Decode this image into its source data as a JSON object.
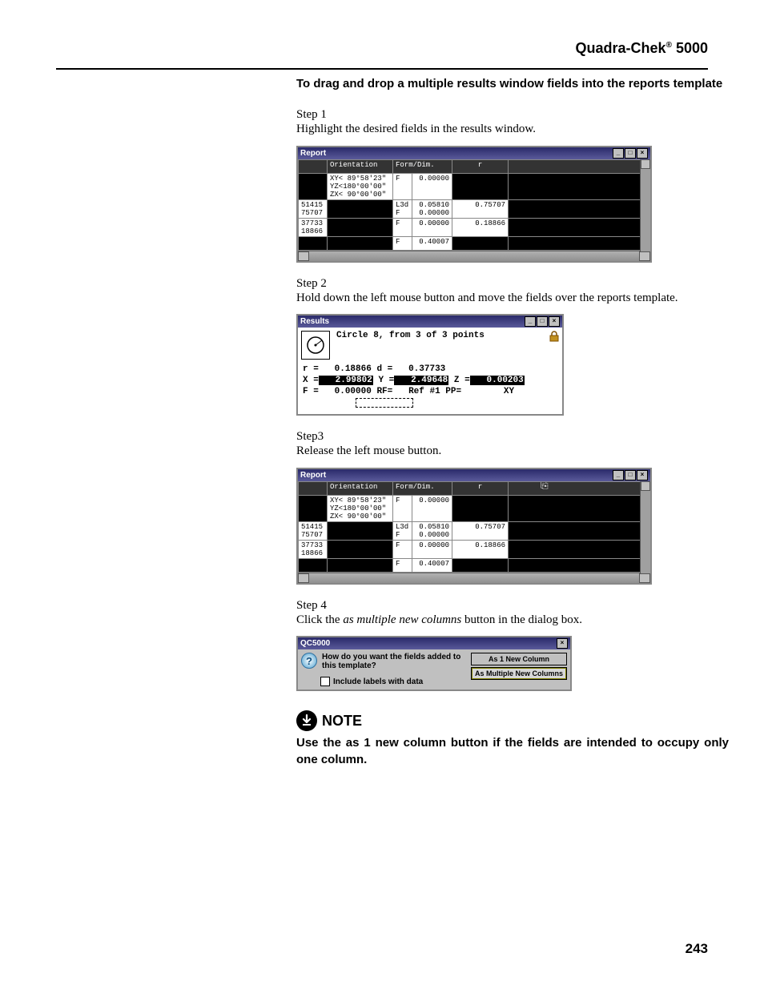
{
  "header": {
    "product": "Quadra-Chek",
    "reg": "®",
    "model": "5000"
  },
  "section_heading": "To drag and drop a multiple results window fields into the reports template",
  "steps": {
    "s1_label": "Step 1",
    "s1_body": "Highlight the desired fields in the results window.",
    "s2_label": "Step 2",
    "s2_body": "Hold down the left mouse button and move the fields over the reports template.",
    "s3_label": "Step3",
    "s3_body": "Release the left mouse button.",
    "s4_label": "Step 4",
    "s4_body_pre": "Click the ",
    "s4_body_ital": "as multiple new columns",
    "s4_body_post": " button in the dialog box."
  },
  "report_win": {
    "title": "Report",
    "headers": {
      "c1": "",
      "c2": "Orientation",
      "c3": "Form/Dim.",
      "c4": "r",
      "c5": ""
    },
    "rows": [
      {
        "c1": "",
        "c2a": "XY< 89°58'23\"",
        "c2b": "YZ<180°00'00\"",
        "c2c": "ZX< 90°00'00\"",
        "c3a": "F",
        "c3b": "0.00000",
        "c4": "",
        "hl": false
      },
      {
        "c1a": "51415",
        "c1b": "75707",
        "c3a": "L3d",
        "c3aval": "0.05810",
        "c3b": "F",
        "c3bval": "0.00000",
        "c4": "0.75707",
        "hl": true
      },
      {
        "c1a": "37733",
        "c1b": "18866",
        "c3a": "F",
        "c3aval": "0.00000",
        "c4": "0.18866",
        "hl": true
      },
      {
        "c3a": "F",
        "c3aval": "0.40007",
        "hl": false
      }
    ]
  },
  "results_win": {
    "title": "Results",
    "desc": "Circle 8, from 3 of 3 points",
    "r_label": "r =",
    "r_val": "0.18866",
    "d_label": "d =",
    "d_val": "0.37733",
    "x_label": "X =",
    "x_val": "2.99802",
    "y_label": "Y =",
    "y_val": "2.49648",
    "z_label": "Z =",
    "z_val": "0.00203",
    "f_label": "F =",
    "f_val": "0.00000",
    "rf_label": "RF=",
    "rf_val": "Ref #1",
    "pp_label": "PP=",
    "pp_val": "XY"
  },
  "dialog": {
    "title": "QC5000",
    "question": "How do you want the fields added to this template?",
    "checkbox": "Include labels with data",
    "btn1": "As 1 New Column",
    "btn2": "As Multiple New Columns"
  },
  "note": {
    "label": "NOTE",
    "text": "Use the as 1 new column button if the fields are intended to occupy only one column."
  },
  "page_number": "243"
}
